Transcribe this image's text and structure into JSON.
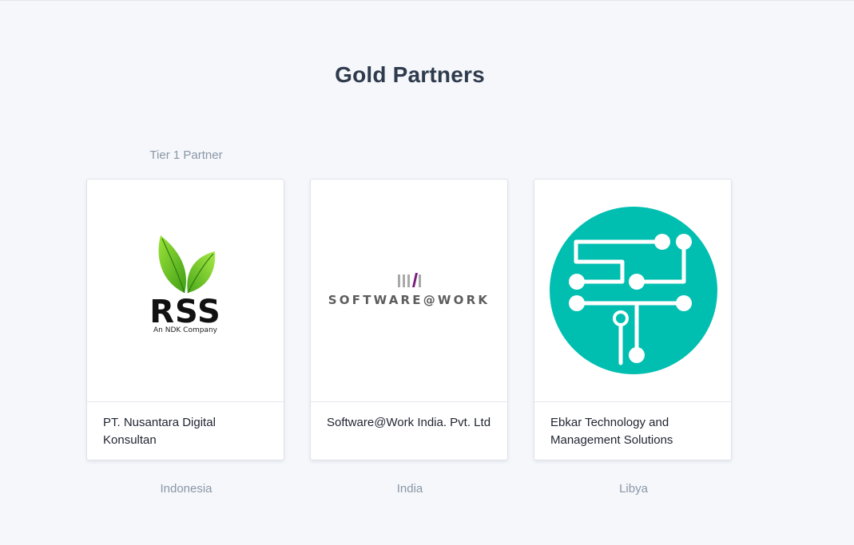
{
  "section": {
    "title": "Gold Partners",
    "tier_label": "Tier 1 Partner"
  },
  "colors": {
    "background": "#f5f7fb",
    "title": "#2f3b4c",
    "muted": "#8b97a6",
    "ebkar_teal": "#00bfb0",
    "rss_green": "#5fbf1f",
    "software_purple": "#7a1e7e"
  },
  "partners": [
    {
      "name": "PT. Nusantara Digital Konsultan",
      "country": "Indonesia",
      "logo": {
        "icon": "rss-leaf-logo",
        "text": "RSS",
        "subtext": "An NDK Company"
      }
    },
    {
      "name": "Software@Work India. Pvt. Ltd",
      "country": "India",
      "logo": {
        "icon": "software-at-work-logo",
        "text": "SOFTWARE@WORK"
      }
    },
    {
      "name": "Ebkar Technology and Management Solutions",
      "country": "Libya",
      "logo": {
        "icon": "ebkar-circuit-logo"
      }
    }
  ]
}
